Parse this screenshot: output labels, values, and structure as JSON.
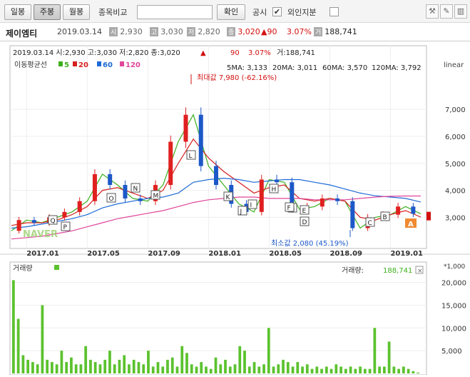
{
  "toolbar": {
    "daily": "일봉",
    "weekly": "주봉",
    "monthly": "월봉",
    "compare_label": "종목비교",
    "compare_value": "",
    "confirm": "확인",
    "disclosure": "공시",
    "disclosure_checked": "✔",
    "foreign": "외인지분",
    "icons": [
      "wrench-icon",
      "edit-icon",
      "trash-icon"
    ]
  },
  "stock": {
    "name": "제이엠티",
    "date": "2019.03.14",
    "open_tag": "시",
    "open": "2,930",
    "high_tag": "고",
    "high": "3,030",
    "low_tag": "저",
    "low": "2,820",
    "close_tag": "종",
    "close": "3,020",
    "change": "▲90",
    "pct": "3.07%",
    "vol_tag": "거",
    "volume": "188,741"
  },
  "chart": {
    "legend_line": "2019.03.14 시:2,930 고:3,030 저:2,820 종:3,020",
    "legend_change": "90",
    "legend_pct": "3.07%",
    "legend_vol": "거:188,741",
    "ma_title": "이동평균선",
    "ma_items": [
      {
        "period": "5",
        "color": "#3cb01f"
      },
      {
        "period": "20",
        "color": "#d61f1f"
      },
      {
        "period": "60",
        "color": "#1e6bd6"
      },
      {
        "period": "120",
        "color": "#e0459a"
      }
    ],
    "ma_values": {
      "ma5": "5MA: 3,133",
      "ma20": "20MA: 3,011",
      "ma60": "60MA: 3,570",
      "ma120": "120MA: 3,792"
    },
    "scale": "linear",
    "max_label": "최대값 7,980 (-62.16%)",
    "min_label": "최소값 2,080 (45.19%)",
    "watermark": "NAVER",
    "price_ticks": [
      "7,000",
      "6,000",
      "5,000",
      "4,000",
      "3,000"
    ],
    "date_ticks": [
      "2017.01",
      "2017.05",
      "2017.09",
      "2018.01",
      "2018.05",
      "2018.09",
      "2019.01"
    ],
    "markers": [
      "Q",
      "P",
      "O",
      "N",
      "M",
      "L",
      "K",
      "J",
      "I",
      "H",
      "G",
      "F",
      "E",
      "D",
      "C",
      "B",
      "A"
    ],
    "current_price": "3,020"
  },
  "volume": {
    "title": "거래량",
    "value_label": "거래량:",
    "value": "188,741",
    "unit": "*1,000",
    "ticks": [
      "20,000",
      "15,000",
      "10,000",
      "5,000"
    ]
  },
  "colors": {
    "up": "#e02020",
    "down": "#1d58c8",
    "volbar": "#5bc22e"
  },
  "chart_data": {
    "type": "line",
    "title": "제이엠티",
    "xlabel": "",
    "ylabel": "",
    "ylim": [
      1900,
      8300
    ],
    "x": [
      "2016.12",
      "2017.01",
      "2017.02",
      "2017.03",
      "2017.04",
      "2017.05",
      "2017.06",
      "2017.07",
      "2017.08",
      "2017.09",
      "2017.10",
      "2017.11",
      "2017.12",
      "2018.01",
      "2018.02",
      "2018.03",
      "2018.04",
      "2018.05",
      "2018.06",
      "2018.07",
      "2018.08",
      "2018.09",
      "2018.10",
      "2018.11",
      "2018.12",
      "2019.01",
      "2019.02",
      "2019.03"
    ],
    "series": [
      {
        "name": "5",
        "values": [
          2500,
          2900,
          2800,
          3000,
          3200,
          3600,
          4600,
          4200,
          3700,
          3600,
          4200,
          5800,
          6800,
          4900,
          4200,
          3500,
          3200,
          4400,
          4300,
          3300,
          3400,
          3700,
          3600,
          2600,
          3000,
          3100,
          3400,
          3133
        ]
      },
      {
        "name": "20",
        "values": [
          2700,
          2800,
          2800,
          2900,
          3100,
          3400,
          4000,
          4100,
          3900,
          3700,
          4000,
          5000,
          5900,
          5200,
          4700,
          4300,
          3900,
          4100,
          4200,
          3700,
          3600,
          3700,
          3600,
          3000,
          2900,
          3100,
          3250,
          3011
        ]
      },
      {
        "name": "60",
        "values": [
          2600,
          2650,
          2750,
          2850,
          2950,
          3100,
          3350,
          3500,
          3600,
          3700,
          3750,
          3900,
          4300,
          4400,
          4450,
          4400,
          4300,
          4350,
          4400,
          4400,
          4300,
          4200,
          4050,
          3900,
          3800,
          3750,
          3700,
          3570
        ]
      },
      {
        "name": "120",
        "values": [
          2200,
          2250,
          2300,
          2400,
          2500,
          2650,
          2800,
          2950,
          3050,
          3150,
          3250,
          3400,
          3550,
          3650,
          3700,
          3750,
          3750,
          3700,
          3700,
          3700,
          3650,
          3650,
          3650,
          3700,
          3750,
          3780,
          3790,
          3792
        ]
      }
    ],
    "volume_series": {
      "name": "거래량",
      "unit": "*1,000",
      "values": [
        20500,
        12000,
        4000,
        3000,
        2500,
        2000,
        15000,
        3000,
        2500,
        2000,
        5000,
        2500,
        3500,
        2000,
        2000,
        6000,
        3000,
        2500,
        2000,
        3000,
        5000,
        2000,
        3000,
        4000,
        2000,
        3000,
        2500,
        2000,
        5000,
        1500,
        2500,
        1500,
        3000,
        3500,
        1500,
        6000,
        4500,
        2000,
        1500,
        2500,
        1500,
        1000,
        3500,
        2000,
        3000,
        1500,
        2000,
        6000,
        5000,
        1500,
        2500,
        1500,
        2000,
        10000,
        1500,
        2000,
        3000,
        2500,
        1500,
        2500,
        1500,
        2000,
        1000,
        1500,
        1000,
        1500,
        1000,
        2000,
        1500,
        1000,
        1500,
        1000,
        1500,
        1000,
        1000,
        10000,
        1500,
        1500,
        7000,
        1500,
        1000,
        1500,
        1000,
        500,
        188.7
      ]
    },
    "annotations": [
      "최대값 7,980 (-62.16%)",
      "최소값 2,080 (45.19%)"
    ]
  }
}
